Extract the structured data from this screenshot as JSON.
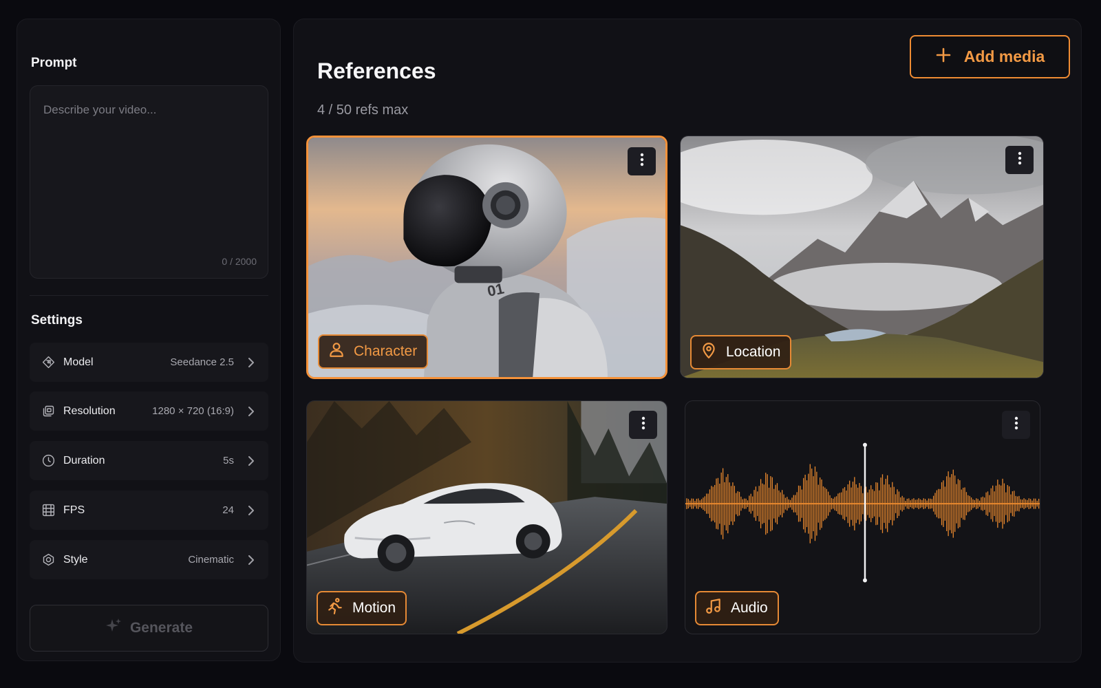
{
  "prompt": {
    "title": "Prompt",
    "placeholder": "Describe your video...",
    "counter": "0 / 2000"
  },
  "settings": {
    "title": "Settings",
    "items": [
      {
        "icon": "model-icon",
        "label": "Model",
        "value": "Seedance 2.5"
      },
      {
        "icon": "resolution-icon",
        "label": "Resolution",
        "value": "1280 × 720 (16:9)"
      },
      {
        "icon": "clock-icon",
        "label": "Duration",
        "value": "5s"
      },
      {
        "icon": "film-frames-icon",
        "label": "FPS",
        "value": "24"
      },
      {
        "icon": "style-icon",
        "label": "Style",
        "value": "Cinematic"
      }
    ]
  },
  "generate": {
    "label": "Generate",
    "icon": "sparkle-icon",
    "disabled": true
  },
  "references": {
    "title": "References",
    "count_text": "4 / 50 refs max",
    "add_media_label": "Add media",
    "cards": [
      {
        "type": "image",
        "tag": "Character",
        "icon": "person-icon",
        "selected": true,
        "content": "astronaut helmet portrait in snowy mountains",
        "helmet_text": "01"
      },
      {
        "type": "image",
        "tag": "Location",
        "icon": "location-pin-icon",
        "selected": false,
        "content": "mountain valley with lake and clouds"
      },
      {
        "type": "image",
        "tag": "Motion",
        "icon": "running-person-icon",
        "selected": false,
        "content": "white sports car on wet forest road"
      },
      {
        "type": "audio",
        "tag": "Audio",
        "icon": "music-note-icon",
        "selected": false,
        "content": "orange audio waveform with playhead"
      }
    ]
  },
  "colors": {
    "accent": "#f39a45",
    "background": "#0a0a0f",
    "panel": "#111116",
    "row": "#17171c"
  }
}
